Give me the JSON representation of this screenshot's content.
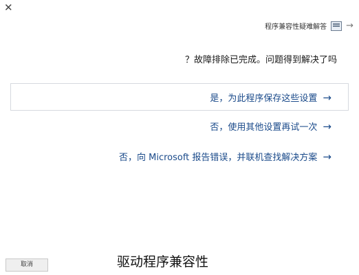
{
  "window": {
    "close_glyph": "✕",
    "title": "程序兼容性疑难解答",
    "back_glyph": "→"
  },
  "question": "故障排除已完成。问题得到解决了吗？",
  "options": [
    {
      "label": "是，为此程序保存这些设置",
      "arrow": "→"
    },
    {
      "label": "否，使用其他设置再试一次",
      "arrow": "→"
    },
    {
      "label": "否，向 Microsoft 报告错误，并联机查找解决方案",
      "arrow": "→"
    }
  ],
  "footer": {
    "cancel_label": "取消",
    "caption": "驱动程序兼容性"
  },
  "colors": {
    "link": "#1a4a8a",
    "border": "#d6d9de"
  },
  "icons": {
    "app": "troubleshooter-icon",
    "back": "back-arrow-icon"
  }
}
